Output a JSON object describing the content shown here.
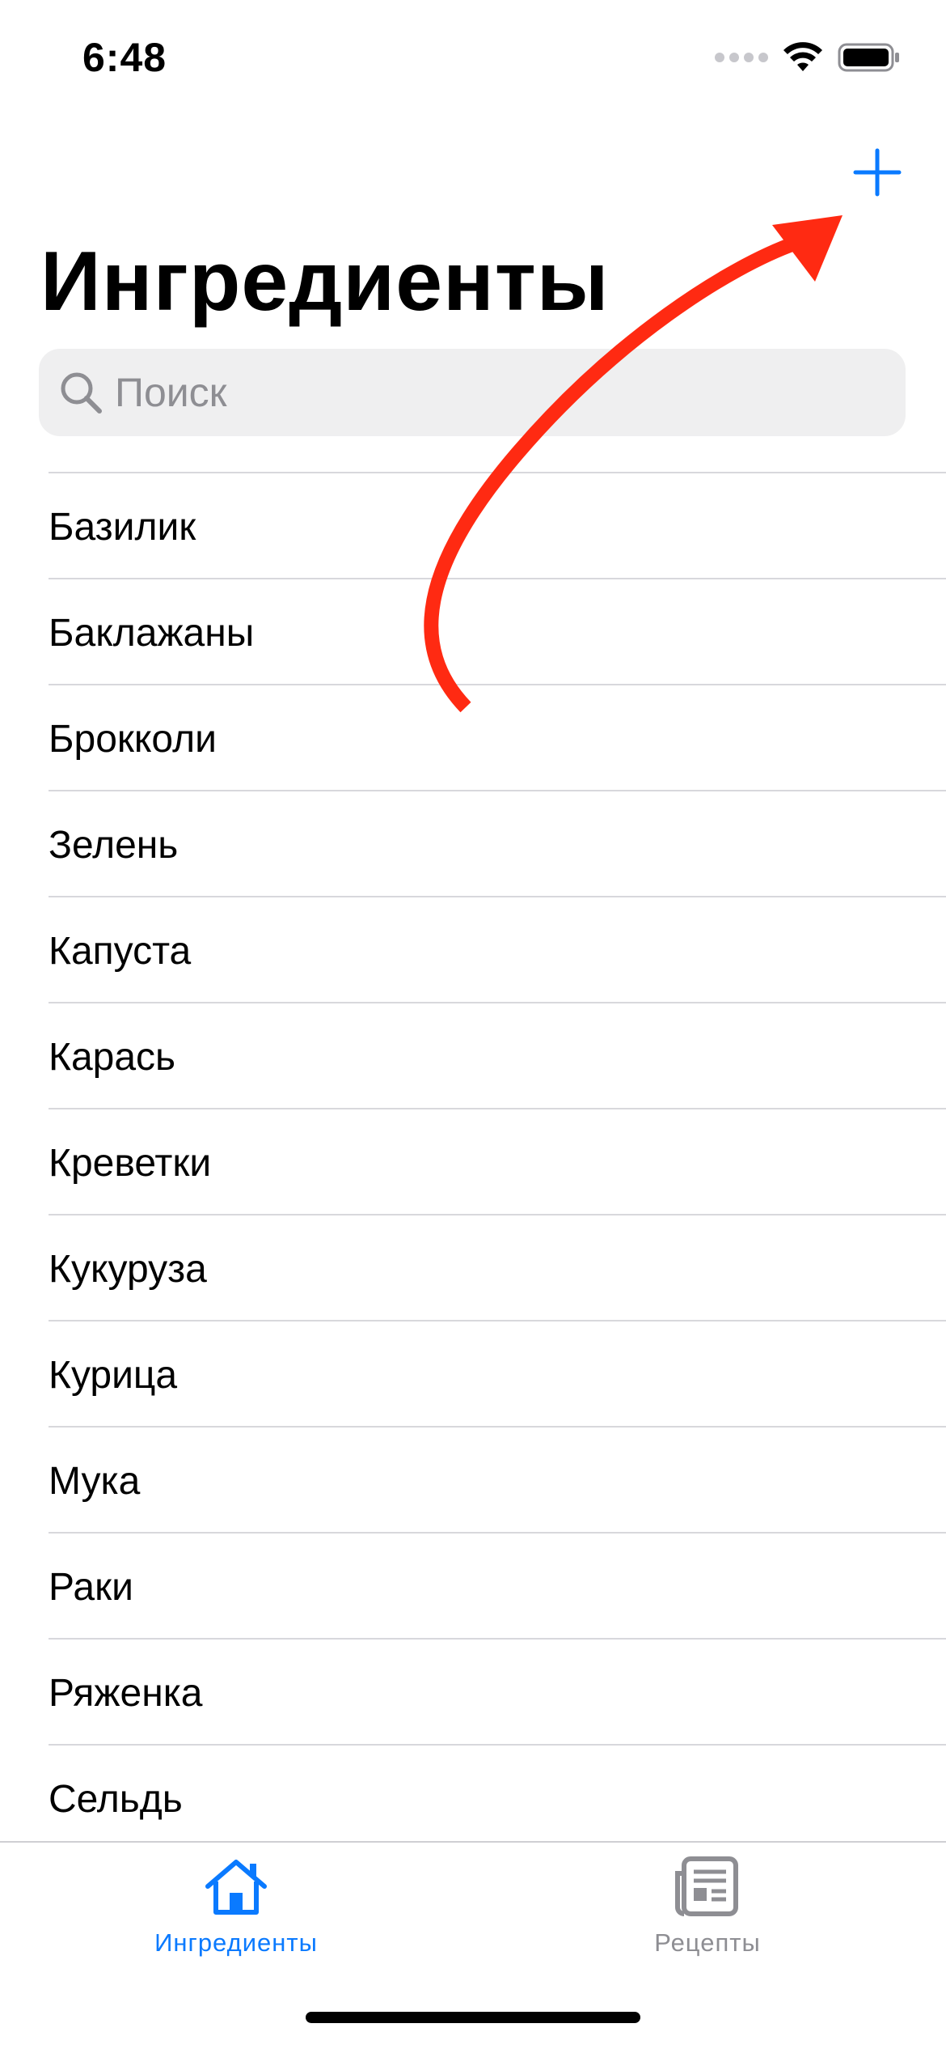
{
  "status_bar": {
    "time": "6:48"
  },
  "nav": {
    "add_icon": "plus-icon",
    "title": "Ингредиенты"
  },
  "search": {
    "icon": "search-icon",
    "placeholder": "Поиск",
    "value": ""
  },
  "ingredients": [
    "Базилик",
    "Баклажаны",
    "Брокколи",
    "Зелень",
    "Капуста",
    "Карась",
    "Креветки",
    "Кукуруза",
    "Курица",
    "Мука",
    "Раки",
    "Ряженка",
    "Сельдь"
  ],
  "tab_bar": {
    "tabs": [
      {
        "label": "Ингредиенты",
        "icon": "house-icon",
        "selected": true
      },
      {
        "label": "Рецепты",
        "icon": "newspaper-icon",
        "selected": false
      }
    ]
  },
  "colors": {
    "accent": "#0a7aff",
    "inactive": "#8e8e93",
    "annotation_arrow": "#ff2a12"
  },
  "annotation": {
    "type": "arrow",
    "points_to": "add-button"
  }
}
